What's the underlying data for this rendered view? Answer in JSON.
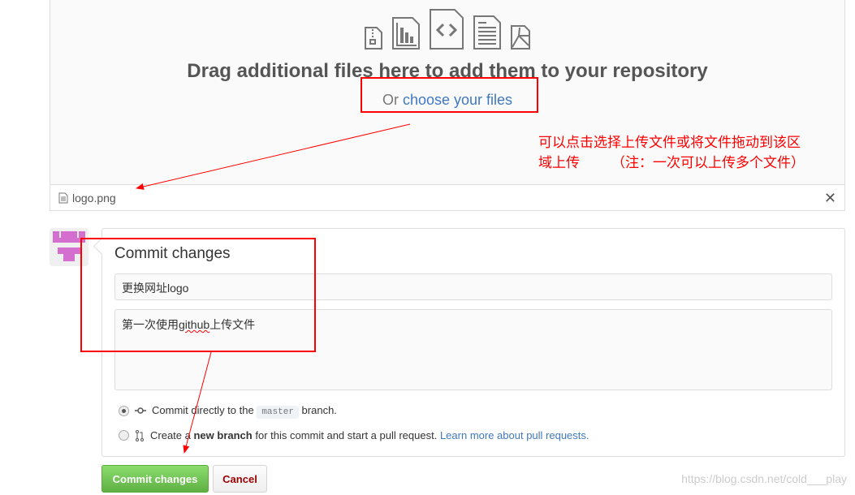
{
  "dropzone": {
    "icons": [
      "file-zip-icon",
      "file-chart-icon",
      "file-code-icon",
      "file-text-icon",
      "file-pdf-icon"
    ],
    "heading": "Drag additional files here to add them to your repository",
    "or_text": "Or ",
    "choose_link": "choose your files"
  },
  "file": {
    "name": "logo.png",
    "close": "✕"
  },
  "commit": {
    "title": "Commit changes",
    "summary_value": "更换网址logo",
    "desc_prefix": "第一次使用",
    "desc_word": "github",
    "desc_suffix": "上传文件",
    "option1": {
      "before": "Commit directly to the ",
      "branch": "master",
      "after": " branch.",
      "selected": true
    },
    "option2": {
      "before": "Create a ",
      "bold": "new branch",
      "after": " for this commit and start a pull request. ",
      "link": "Learn more about pull requests.",
      "selected": false
    }
  },
  "buttons": {
    "commit": "Commit changes",
    "cancel": "Cancel"
  },
  "annotation": {
    "line1": "可以点击选择上传文件或将文件拖动到该区",
    "line2": "域上传",
    "note": "（注：一次可以上传多个文件）",
    "color": "#ff0000"
  },
  "watermark": "https://blog.csdn.net/cold___play"
}
